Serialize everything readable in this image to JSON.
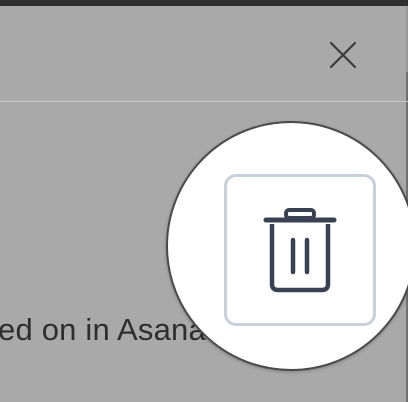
{
  "dialog": {
    "body_text": "ed on in Asana.",
    "close_icon": "close-icon"
  },
  "magnifier": {
    "delete_button_icon": "trash-icon"
  },
  "colors": {
    "overlay": "#a9a9a9",
    "text": "#2e2e2e",
    "icon": "#3a4152",
    "button_border": "#c9cfdb"
  }
}
